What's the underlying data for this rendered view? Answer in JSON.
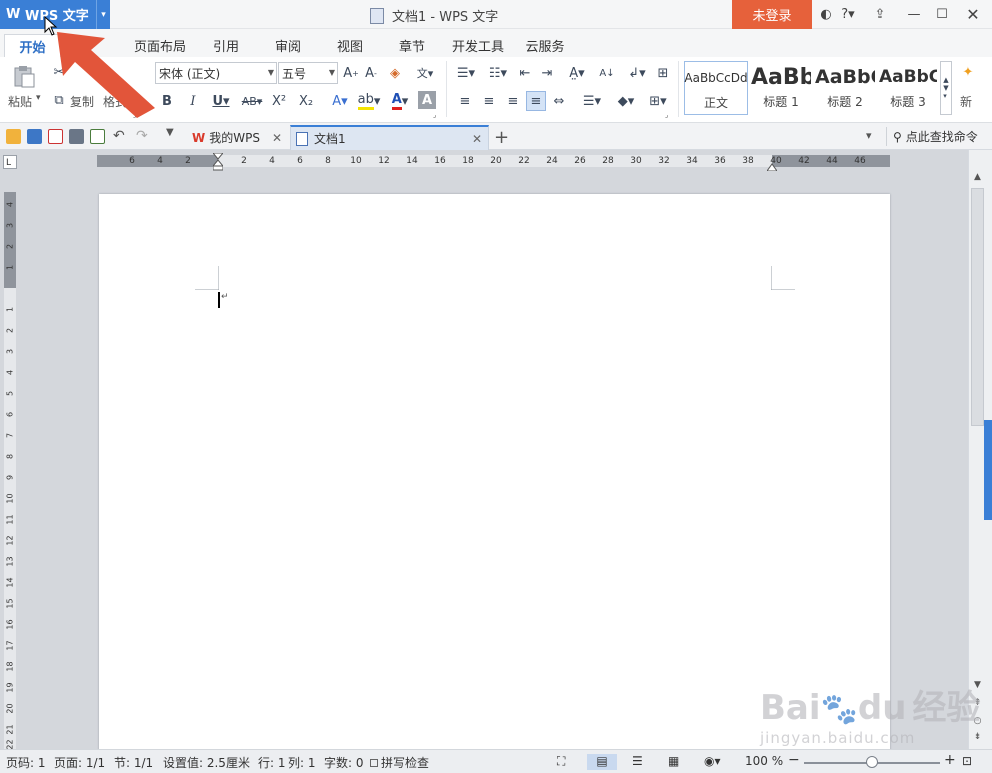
{
  "app": {
    "button_label": "WPS 文字",
    "window_title": "文档1 - WPS 文字",
    "login_label": "未登录"
  },
  "tabs": [
    "开始",
    "页面布局",
    "引用",
    "审阅",
    "视图",
    "章节",
    "开发工具",
    "云服务"
  ],
  "ribbon": {
    "paste_label": "粘贴",
    "copy_label": "复制",
    "format_label": "格式",
    "font_name": "宋体 (正文)",
    "font_size": "五号",
    "styles": [
      {
        "preview": "AaBbCcDd",
        "name": "正文"
      },
      {
        "preview": "AaBb",
        "name": "标题 1"
      },
      {
        "preview": "AaBbC",
        "name": "标题 2"
      },
      {
        "preview": "AaBbC",
        "name": "标题 3"
      }
    ],
    "new_style_label": "新"
  },
  "doc_tabs": [
    {
      "label": "我的WPS"
    },
    {
      "label": "文档1"
    }
  ],
  "search_command_label": "点此查找命令",
  "hruler_numbers": [
    "6",
    "4",
    "2",
    "2",
    "4",
    "6",
    "8",
    "10",
    "12",
    "14",
    "16",
    "18",
    "20",
    "22",
    "24",
    "26",
    "28",
    "30",
    "32",
    "34",
    "36",
    "38",
    "40",
    "42",
    "44",
    "46"
  ],
  "vruler_numbers": [
    "4",
    "3",
    "2",
    "1",
    "1",
    "2",
    "3",
    "4",
    "5",
    "6",
    "7",
    "8",
    "9",
    "10",
    "11",
    "12",
    "13",
    "14",
    "15",
    "16",
    "17",
    "18",
    "19",
    "20",
    "21",
    "22"
  ],
  "status": {
    "page_code": "页码: 1",
    "pages": "页面: 1/1",
    "section": "节: 1/1",
    "setting": "设置值: 2.5厘米",
    "row": "行: 1",
    "col": "列: 1",
    "word_count": "字数: 0",
    "spellcheck": "拼写检查",
    "zoom": "100 %"
  },
  "watermark": {
    "brand": "Bai",
    "brand2": "du",
    "cn": "经验",
    "url": "jingyan.baidu.com"
  },
  "colors": {
    "app_blue": "#3a7fd6",
    "login_orange": "#e6613b",
    "arrow_red": "#e2553a"
  }
}
